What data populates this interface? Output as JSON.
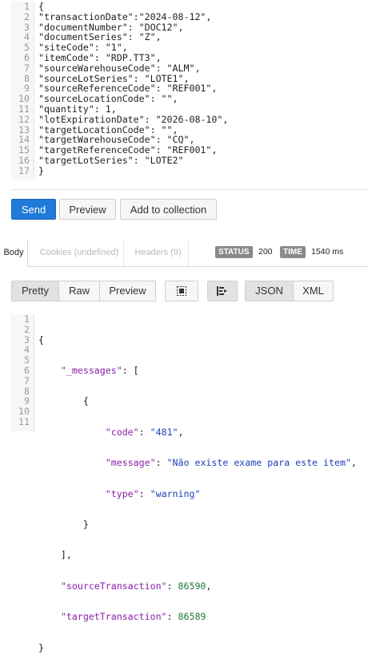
{
  "request": {
    "line_numbers": [
      "1",
      "2",
      "3",
      "4",
      "5",
      "6",
      "7",
      "8",
      "9",
      "10",
      "11",
      "12",
      "13",
      "14",
      "15",
      "16",
      "17"
    ],
    "lines": [
      "{",
      "\"transactionDate\":\"2024-08-12\",",
      "\"documentNumber\": \"DOC12\",",
      "\"documentSeries\": \"Z\",",
      "\"siteCode\": \"1\",",
      "\"itemCode\": \"RDP.TT3\",",
      "\"sourceWarehouseCode\": \"ALM\",",
      "\"sourceLotSeries\": \"LOTE1\",",
      "\"sourceReferenceCode\": \"REF001\",",
      "\"sourceLocationCode\": \"\",",
      "\"quantity\": 1,",
      "\"lotExpirationDate\": \"2026-08-10\",",
      "\"targetLocationCode\": \"\",",
      "\"targetWarehouseCode\": \"CQ\",",
      "\"targetReferenceCode\": \"REF001\",",
      "\"targetLotSeries\": \"LOTE2\"",
      "}"
    ]
  },
  "actions": {
    "send": "Send",
    "preview": "Preview",
    "add_to_collection": "Add to collection"
  },
  "response_tabs": {
    "body": "Body",
    "cookies": "Cookies (undefined)",
    "headers": "Headers (9)",
    "status_label": "STATUS",
    "status_value": "200",
    "time_label": "TIME",
    "time_value": "1540 ms"
  },
  "response_toolbar": {
    "pretty": "Pretty",
    "raw": "Raw",
    "preview": "Preview",
    "json": "JSON",
    "xml": "XML",
    "copy_icon": "square-target-icon",
    "wrap_icon": "wrap-lines-icon"
  },
  "response": {
    "line_numbers": [
      "1",
      "2",
      "3",
      "4",
      "5",
      "6",
      "7",
      "8",
      "9",
      "10",
      "11"
    ],
    "l1": "{",
    "messages_key": "\"_messages\"",
    "messages_open": ": [",
    "obj_open": "{",
    "code_key": "\"code\"",
    "code_val": "\"481\"",
    "message_key": "\"message\"",
    "message_val": "\"Não existe exame para este item\"",
    "type_key": "\"type\"",
    "type_val": "\"warning\"",
    "obj_close": "}",
    "arr_close": "],",
    "source_key": "\"sourceTransaction\"",
    "source_val": "86590",
    "target_key": "\"targetTransaction\"",
    "target_val": "86589",
    "l11": "}"
  },
  "colors": {
    "send_blue": "#1f7ad8",
    "json_key": "#8a1fa8",
    "json_string": "#1f3fb8",
    "json_number": "#1b7a36"
  }
}
